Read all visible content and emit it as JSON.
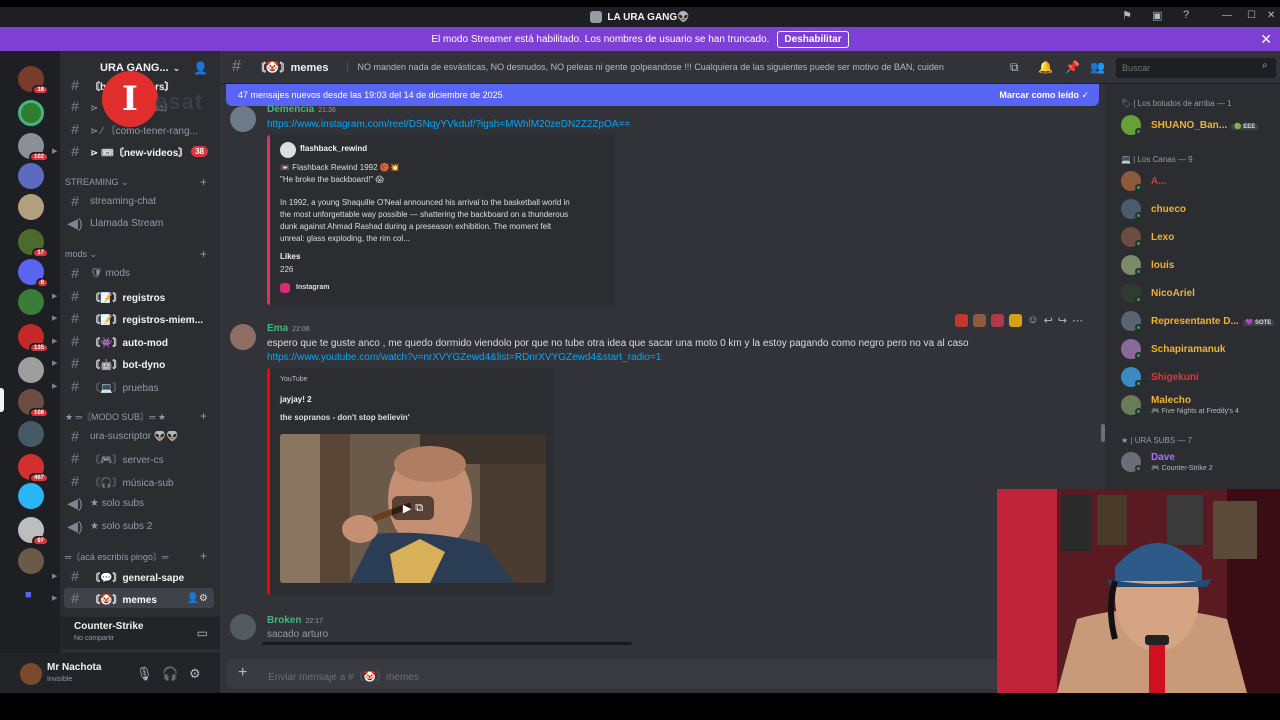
{
  "window": {
    "title": "LA URA GANG👽"
  },
  "banner": {
    "text": "El modo Streamer está habilitado. Los nombres de usuario se han truncado.",
    "button": "Deshabilitar"
  },
  "server": {
    "name": "URA GANG..."
  },
  "watermark": {
    "letter": "I",
    "text": "esat"
  },
  "rail": {
    "badges": [
      "18",
      "102",
      "17",
      "8",
      "135",
      "108",
      "467",
      "97"
    ]
  },
  "sidebar": {
    "top_channels": [
      {
        "name": "〘boost-honors〙"
      },
      {
        "name": "⋗ 🔖〘anuncios〙"
      },
      {
        "name": "⋗ ⁄ 〘como-tener-rang..."
      },
      {
        "name": "⋗ 🎟〘new-videos〙",
        "badge": "38"
      }
    ],
    "cat_streaming": "STREAMING",
    "streaming_channels": [
      "streaming-chat",
      "Llamada Stream"
    ],
    "cat_mods": "mods",
    "mods_channels": [
      "🛡 mods",
      "〘📝〙registros",
      "〘📝〙registros-miem...",
      "〘👾〙auto-mod",
      "〘🤖〙bot-dyno",
      "〘💻〙pruebas"
    ],
    "cat_modo_sub": "★ ═〘MODO SUB〙═ ★",
    "sub_channels": [
      "ura-suscriptor 👽👽",
      "〘🎮〙server-cs",
      "〘🎧〙música-sub",
      "★ solo subs",
      "★ solo subs 2"
    ],
    "cat_aca": "═〘acá escribís pingo〙═",
    "aca_channels": [
      "〘💬〙general-sape",
      "〘🤡〙memes"
    ]
  },
  "voice": {
    "title": "Counter-Strike",
    "subtitle": "No compartir"
  },
  "user": {
    "name": "Mr Nachota",
    "status": "Invisible"
  },
  "header": {
    "channel": "〘🤡〙memes",
    "topic": "NO manden nada de esvásticas, NO desnudos, NO peleas ni gente golpeandose !!! Cualquiera de las siguientes puede ser motivo de BAN, cuiden el stream!",
    "search_placeholder": "Buscar"
  },
  "new_messages": {
    "text": "47 mensajes nuevos desde las 19:03 del 14 de diciembre de 2025",
    "action": "Marcar como leído"
  },
  "messages": [
    {
      "author": "Demencia",
      "time": "21:36",
      "author_color": "#43b581",
      "link": "https://www.instagram.com/reel/DSNqyYVkduf/?igsh=MWhlM20zeDN2Z2ZpOA==",
      "embed": {
        "account": "flashback_rewind",
        "line1": "📼 Flashback Rewind 1992 🏀💥",
        "line2": "\"He broke the backboard!\" 😱",
        "body1": "In 1992, a young Shaquille O'Neal announced his arrival to the basketball world in",
        "body2": "the most unforgettable way possible — shattering the backboard on a thunderous",
        "body3": "dunk against Ahmad Rashad during a preseason exhibition. The moment felt",
        "body4": "unreal: glass exploding, the rim col...",
        "likes_label": "Likes",
        "likes": "226",
        "provider": "Instagram"
      }
    },
    {
      "author": "Ema",
      "time": "22:06",
      "author_color": "#43b581",
      "text": "espero que te guste anco , me quedo dormido viendolo por que no tube otra idea que sacar una moto 0 km y la estoy pagando como negro pero no va al caso",
      "link": "https://www.youtube.com/watch?v=nrXVYGZewd4&list=RDnrXVYGZewd4&start_radio=1",
      "embed": {
        "provider": "YouTube",
        "author": "jayjay! 2",
        "title": "the sopranos - don't stop believin'"
      }
    },
    {
      "author": "Broken",
      "time": "22:17",
      "author_color": "#43b581",
      "text": "sacado arturo"
    }
  ],
  "composer": {
    "placeholder": "Enviar mensaje a #〘🤡〙memes"
  },
  "members": {
    "groups": [
      {
        "label": "🏷 | Los boludos de arriba — 1"
      },
      {
        "label": "💻 | Los Canas — 9"
      },
      {
        "label": "★ | URA SUBS — 7"
      }
    ],
    "list": [
      {
        "name": "SHUANO_Ban...",
        "color": "#f0b232",
        "tag": "🟢 EEE"
      },
      {
        "name": "A...",
        "color": "#da373c"
      },
      {
        "name": "chueco",
        "color": "#f0b232"
      },
      {
        "name": "Lexo",
        "color": "#f0b232"
      },
      {
        "name": "louis",
        "color": "#f0b232"
      },
      {
        "name": "NicoAriel",
        "color": "#f0b232"
      },
      {
        "name": "Representante D...",
        "color": "#f0b232",
        "tag": "💜 SOTE"
      },
      {
        "name": "Schapiramanuk",
        "color": "#f0b232"
      },
      {
        "name": "Shigekuni",
        "color": "#da373c"
      },
      {
        "name": "Malecho",
        "color": "#f0b232",
        "activity": "🎮 Five Nights at Freddy's 4"
      },
      {
        "name": "Dave",
        "color": "#a970ff",
        "activity": "🎮 Counter-Strike 2"
      }
    ]
  },
  "colors": {
    "accent": "#5865f2",
    "streamer": "#7e3fd5",
    "link": "#00a8fc"
  }
}
